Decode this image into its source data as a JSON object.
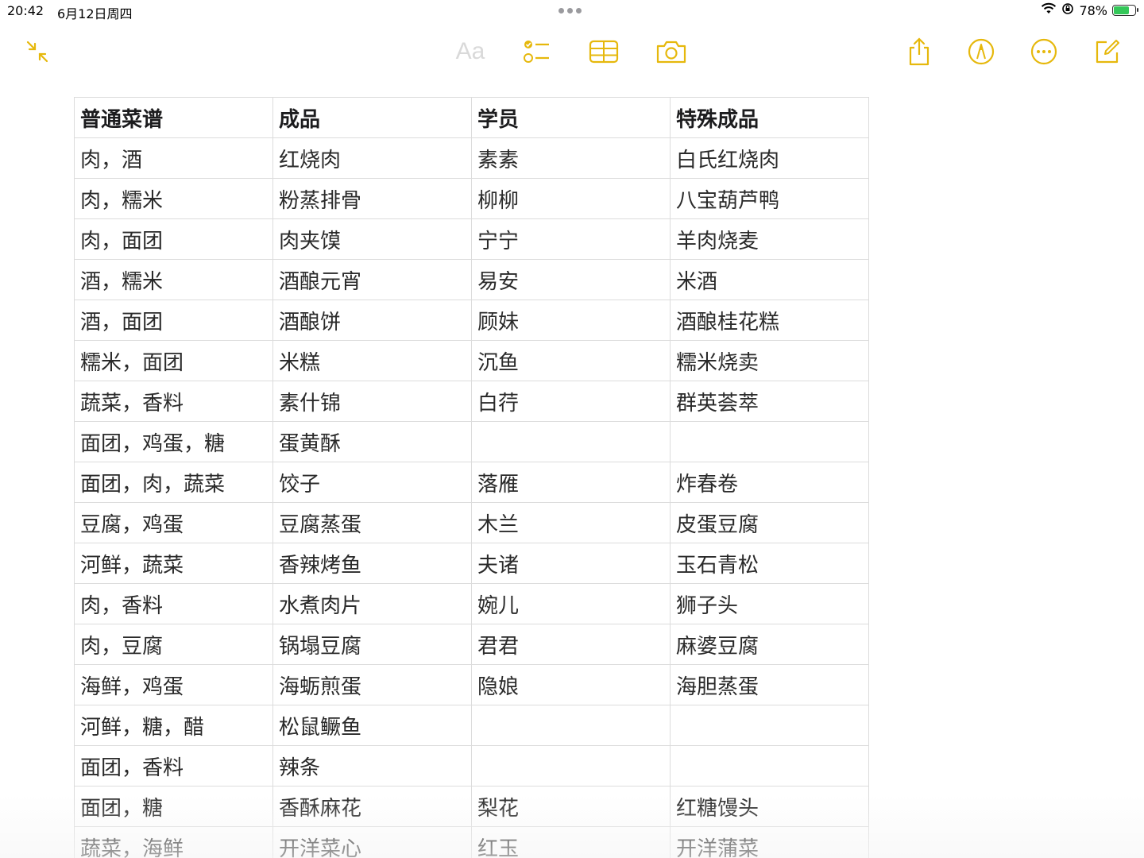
{
  "status_bar": {
    "time": "20:42",
    "date": "6月12日周四",
    "battery_percent": "78%",
    "battery_level": 0.78
  },
  "toolbar": {
    "format_label": "Aa",
    "icons": [
      "collapse-icon",
      "checklist-icon",
      "table-icon",
      "camera-icon",
      "share-icon",
      "markup-icon",
      "more-icon",
      "compose-icon"
    ],
    "accent_color": "#e6b80c"
  },
  "table": {
    "headers": [
      "普通菜谱",
      "成品",
      "学员",
      "特殊成品"
    ],
    "rows": [
      [
        "肉，酒",
        "红烧肉",
        "素素",
        "白氏红烧肉"
      ],
      [
        "肉，糯米",
        "粉蒸排骨",
        "柳柳",
        "八宝葫芦鸭"
      ],
      [
        "肉，面团",
        "肉夹馍",
        "宁宁",
        "羊肉烧麦"
      ],
      [
        "酒，糯米",
        "酒酿元宵",
        "易安",
        "米酒"
      ],
      [
        "酒，面团",
        "酒酿饼",
        "顾妹",
        "酒酿桂花糕"
      ],
      [
        "糯米，面团",
        "米糕",
        "沉鱼",
        "糯米烧卖"
      ],
      [
        "蔬菜，香料",
        "素什锦",
        "白荇",
        "群英荟萃"
      ],
      [
        "面团，鸡蛋，糖",
        "蛋黄酥",
        "",
        ""
      ],
      [
        "面团，肉，蔬菜",
        "饺子",
        "落雁",
        "炸春卷"
      ],
      [
        "豆腐，鸡蛋",
        "豆腐蒸蛋",
        "木兰",
        "皮蛋豆腐"
      ],
      [
        "河鲜，蔬菜",
        "香辣烤鱼",
        "夫诸",
        "玉石青松"
      ],
      [
        "肉，香料",
        "水煮肉片",
        "婉儿",
        "狮子头"
      ],
      [
        "肉，豆腐",
        "锅塌豆腐",
        "君君",
        "麻婆豆腐"
      ],
      [
        "海鲜，鸡蛋",
        "海蛎煎蛋",
        "隐娘",
        "海胆蒸蛋"
      ],
      [
        "河鲜，糖，醋",
        "松鼠鳜鱼",
        "",
        ""
      ],
      [
        "面团，香料",
        "辣条",
        "",
        ""
      ],
      [
        "面团，糖",
        "香酥麻花",
        "梨花",
        "红糖馒头"
      ],
      [
        "蔬菜，海鲜",
        "开洋菜心",
        "红玉",
        "开洋蒲菜"
      ]
    ]
  }
}
